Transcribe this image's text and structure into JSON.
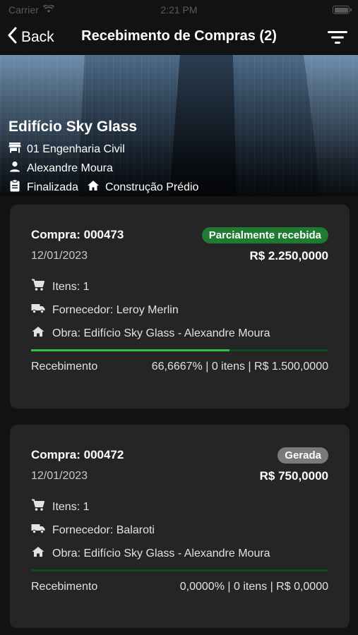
{
  "status_bar": {
    "carrier": "Carrier",
    "time": "2:21 PM"
  },
  "nav": {
    "back_label": "Back",
    "title": "Recebimento de Compras (2)"
  },
  "project": {
    "name": "Edifício Sky Glass",
    "company": "01 Engenharia Civil",
    "person": "Alexandre Moura",
    "status": "Finalizada",
    "type": "Construção Prédio"
  },
  "purchases": [
    {
      "number": "Compra: 000473",
      "badge": "Parcialmente recebida",
      "badge_color": "#1f7a32",
      "date": "12/01/2023",
      "amount": "R$ 2.250,0000",
      "items": "Itens: 1",
      "supplier": "Fornecedor: Leroy Merlin",
      "site": "Obra: Edifício Sky Glass - Alexandre Moura",
      "progress_percent": 66.6667,
      "receipt_label": "Recebimento",
      "receipt_value": "66,6667% | 0 itens | R$ 1.500,0000"
    },
    {
      "number": "Compra: 000472",
      "badge": "Gerada",
      "badge_color": "#7a7a7a",
      "date": "12/01/2023",
      "amount": "R$ 750,0000",
      "items": "Itens: 1",
      "supplier": "Fornecedor: Balaroti",
      "site": "Obra: Edifício Sky Glass - Alexandre Moura",
      "progress_percent": 0,
      "receipt_label": "Recebimento",
      "receipt_value": "0,0000% | 0 itens | R$ 0,0000"
    }
  ],
  "colors": {
    "background": "#121212",
    "card": "#252525",
    "progress_fill": "#2fbf43",
    "progress_track": "#124a22"
  }
}
